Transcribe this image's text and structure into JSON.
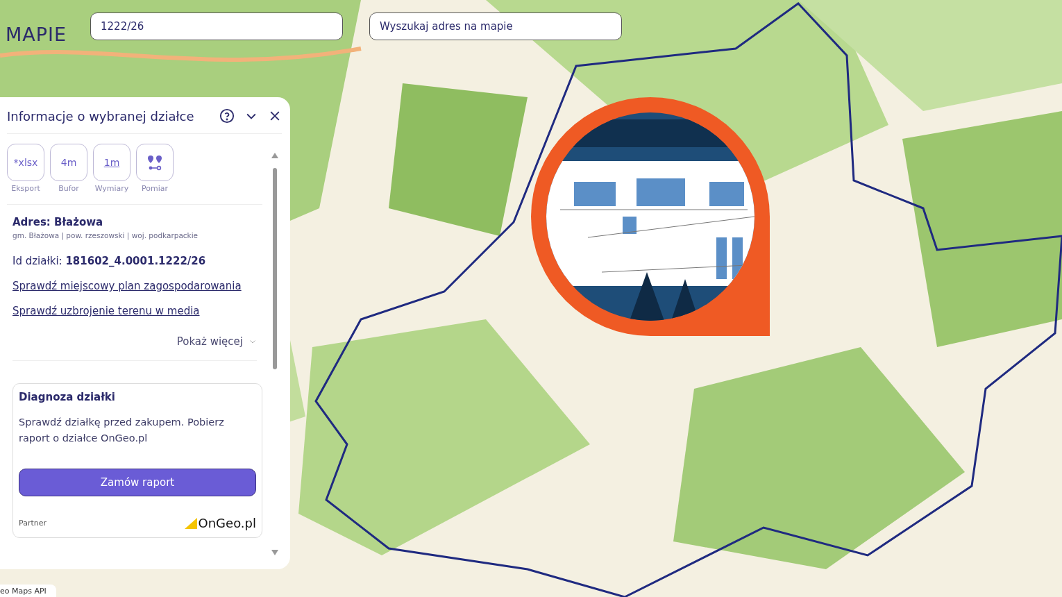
{
  "logo": {
    "text": "MAPIE"
  },
  "search_fields": [
    {
      "value": "1222/26"
    },
    {
      "placeholder": "Wyszukaj adres na mapie"
    }
  ],
  "panel": {
    "title": "Informacje o wybranej działce",
    "tools": [
      {
        "kind": "text",
        "icon_text": "*xlsx",
        "label": "Eksport"
      },
      {
        "kind": "text",
        "icon_text": "4m",
        "label": "Bufor"
      },
      {
        "kind": "dimension",
        "icon_text": "1m",
        "label": "Wymiary"
      },
      {
        "kind": "pins",
        "label": "Pomiar"
      }
    ],
    "address": "Adres: Błażowa",
    "address_detail": "gm. Błażowa | pow. rzeszowski | woj. podkarpackie",
    "parcel_id": "Id działki: **181602_4.0001.1222/26**",
    "links": [
      "Sprawdź miejscowy plan zagospodarowania",
      "Sprawdź uzbrojenie terenu w media"
    ],
    "show_more": "Pokaż więcej",
    "card": {
      "title": "Diagnoza działki",
      "text": "Sprawdź działkę przed zakupem. Pobierz raport o działce OnGeo.pl",
      "button": "Zamów raport",
      "partner": "Partner",
      "brand": "OnGeo.pl"
    }
  },
  "attribution": "eo Maps API"
}
